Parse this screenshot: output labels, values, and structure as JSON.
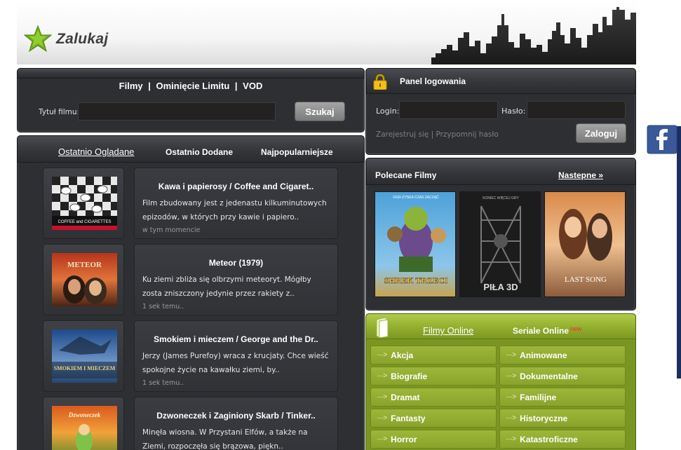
{
  "header": {
    "logo_text": "Zalukaj"
  },
  "search": {
    "links": [
      "Filmy",
      "Ominięcie Limitu",
      "VOD"
    ],
    "separator": "|",
    "title_label": "Tytuł filmu:",
    "button": "Szukaj"
  },
  "recent": {
    "tabs": [
      "Ostatnio Oglądane",
      "Ostatnio Dodane",
      "Najpopularniejsze"
    ],
    "items": [
      {
        "title": "Kawa i papierosy / Coffee and Cigaret..",
        "desc": "Film zbudowany jest z jedenastu kilkuminutowych epizodów, w których przy kawie i papiero..",
        "time": "w tym momencie",
        "poster_caption": "COFFEE and CIGARETTES"
      },
      {
        "title": "Meteor (1979)",
        "desc": "Ku ziemi zbliża się olbrzymi meteoryt. Mógłby zosta zniszczony jedynie przez rakiety z..",
        "time": "1 sek temu..",
        "poster_caption": "METEOR"
      },
      {
        "title": "Smokiem i mieczem / George and the Dr..",
        "desc": "Jerzy (James Purefoy) wraca z krucjaty. Chce wieść spokojne życie na kawałku ziemi, by..",
        "time": "1 sek temu..",
        "poster_caption": "SMOKIEM I MIECZEM"
      },
      {
        "title": "Dzwoneczek i Zaginiony Skarb / Tinker..",
        "desc": "Minęła wiosna. W Przystani Elfów, a także na Ziemi, rozpoczęła się brązowa, piękn..",
        "time": "",
        "poster_caption": "Dzwoneczek"
      }
    ]
  },
  "login": {
    "title": "Panel logowania",
    "login_label": "Login:",
    "password_label": "Hasło:",
    "register": "Zarejestruj się",
    "separator": "|",
    "remind": "Przypomnij hasło",
    "button": "Zaloguj"
  },
  "recommended": {
    "title": "Polecane Filmy",
    "next": "Nastepne »",
    "posters": [
      {
        "caption": "SHREK TRZECI",
        "tagline": "OGR-ZYSKA CZAS ZACZĄĆ"
      },
      {
        "caption": "PIŁA 3D",
        "tagline": "KONIEC WIĘCEJ GRY"
      },
      {
        "caption": "LAST SONG",
        "tagline": ""
      }
    ]
  },
  "genres": {
    "tabs": [
      "Filmy Online",
      "Seriale Online"
    ],
    "new_badge": "new",
    "arrow": "····>",
    "items": [
      "Akcja",
      "Animowane",
      "Biografie",
      "Dokumentalne",
      "Dramat",
      "Familijne",
      "Fantasty",
      "Historyczne",
      "Horror",
      "Katastroficzne"
    ]
  },
  "social": {
    "facebook_icon": "facebook-icon"
  },
  "colors": {
    "panel": "#2d2f33",
    "green": "#7a9521",
    "facebook": "#3b5998"
  }
}
